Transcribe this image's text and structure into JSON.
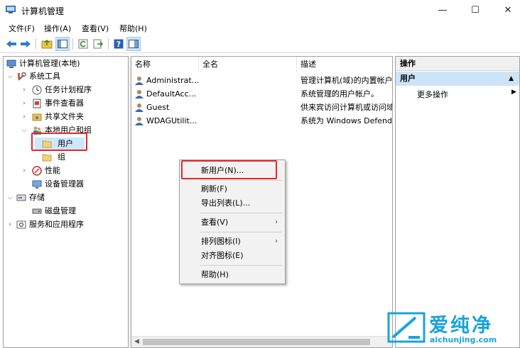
{
  "window": {
    "title": "计算机管理",
    "minimize": "—",
    "maximize": "☐",
    "close": "✕"
  },
  "menu": [
    "文件(F)",
    "操作(A)",
    "查看(V)",
    "帮助(H)"
  ],
  "toolbar": {
    "icons": [
      "back-icon",
      "forward-icon",
      "up-folder-icon",
      "show-tree-icon",
      "refresh-icon",
      "export-icon",
      "help-icon",
      "properties-icon"
    ]
  },
  "tree": {
    "root": "计算机管理(本地)",
    "system_tools": "系统工具",
    "task_scheduler": "任务计划程序",
    "event_viewer": "事件查看器",
    "shared_folders": "共享文件夹",
    "local_users_groups": "本地用户和组",
    "users": "用户",
    "groups": "组",
    "performance": "性能",
    "device_manager": "设备管理器",
    "storage": "存储",
    "disk_management": "磁盘管理",
    "services_apps": "服务和应用程序"
  },
  "list": {
    "columns": [
      "名称",
      "全名",
      "描述"
    ],
    "rows": [
      {
        "name": "Administrat...",
        "full_name": "",
        "desc": "管理计算机(域)的内置帐户"
      },
      {
        "name": "DefaultAcc...",
        "full_name": "",
        "desc": "系统管理的用户帐户。"
      },
      {
        "name": "Guest",
        "full_name": "",
        "desc": "供来宾访问计算机或访问域"
      },
      {
        "name": "WDAGUtilit...",
        "full_name": "",
        "desc": "系统为 Windows Defend"
      }
    ]
  },
  "actions": {
    "header": "操作",
    "section": "用户",
    "more": "更多操作"
  },
  "context_menu": {
    "new_user": "新用户(N)...",
    "refresh": "刷新(F)",
    "export_list": "导出列表(L)...",
    "view": "查看(V)",
    "arrange_icons": "排列图标(I)",
    "line_up_icons": "对齐图标(E)",
    "help": "帮助(H)"
  },
  "watermark": {
    "title": "爱纯净",
    "url": "aichunjing.com"
  },
  "colors": {
    "highlight_red": "#e8272a",
    "selection": "#cce8ff",
    "watermark_blue": "#1aa3dc"
  }
}
